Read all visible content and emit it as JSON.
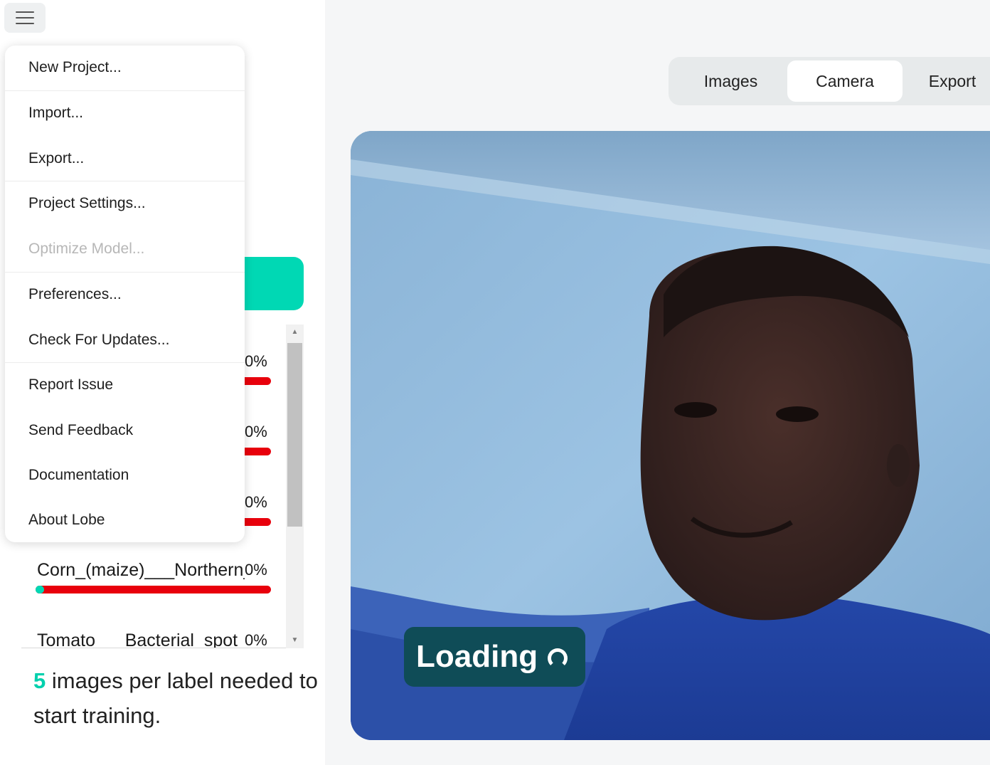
{
  "menu": {
    "items": [
      {
        "label": "New Project...",
        "enabled": true
      },
      {
        "label": "Import...",
        "enabled": true
      },
      {
        "label": "Export...",
        "enabled": true
      },
      {
        "label": "Project Settings...",
        "enabled": true
      },
      {
        "label": "Optimize Model...",
        "enabled": false
      },
      {
        "label": "Preferences...",
        "enabled": true
      },
      {
        "label": "Check For Updates...",
        "enabled": true
      },
      {
        "label": "Report Issue",
        "enabled": true
      },
      {
        "label": "Send Feedback",
        "enabled": true
      },
      {
        "label": "Documentation",
        "enabled": true
      },
      {
        "label": "About Lobe",
        "enabled": true
      }
    ]
  },
  "labels": [
    {
      "name": "",
      "percent": "0%",
      "progress": 0
    },
    {
      "name": "",
      "percent": "0%",
      "progress": 0
    },
    {
      "name": "",
      "percent": "0%",
      "progress": 0
    },
    {
      "name": "Corn_(maize)___Northern_Leaf_Blight",
      "percent": "0%",
      "progress": 0.02
    },
    {
      "name": "Tomato___Bacterial_spot",
      "percent": "0%",
      "progress": 0
    }
  ],
  "training_hint": {
    "count": "5",
    "text": " images per label needed to start training."
  },
  "tabs": [
    {
      "label": "Images",
      "active": false
    },
    {
      "label": "Camera",
      "active": true
    },
    {
      "label": "Export",
      "active": false
    }
  ],
  "camera": {
    "status": "Loading"
  },
  "colors": {
    "accent": "#00d8b4",
    "bar_empty": "#e8000c",
    "loading_bg": "#0f4c57"
  }
}
